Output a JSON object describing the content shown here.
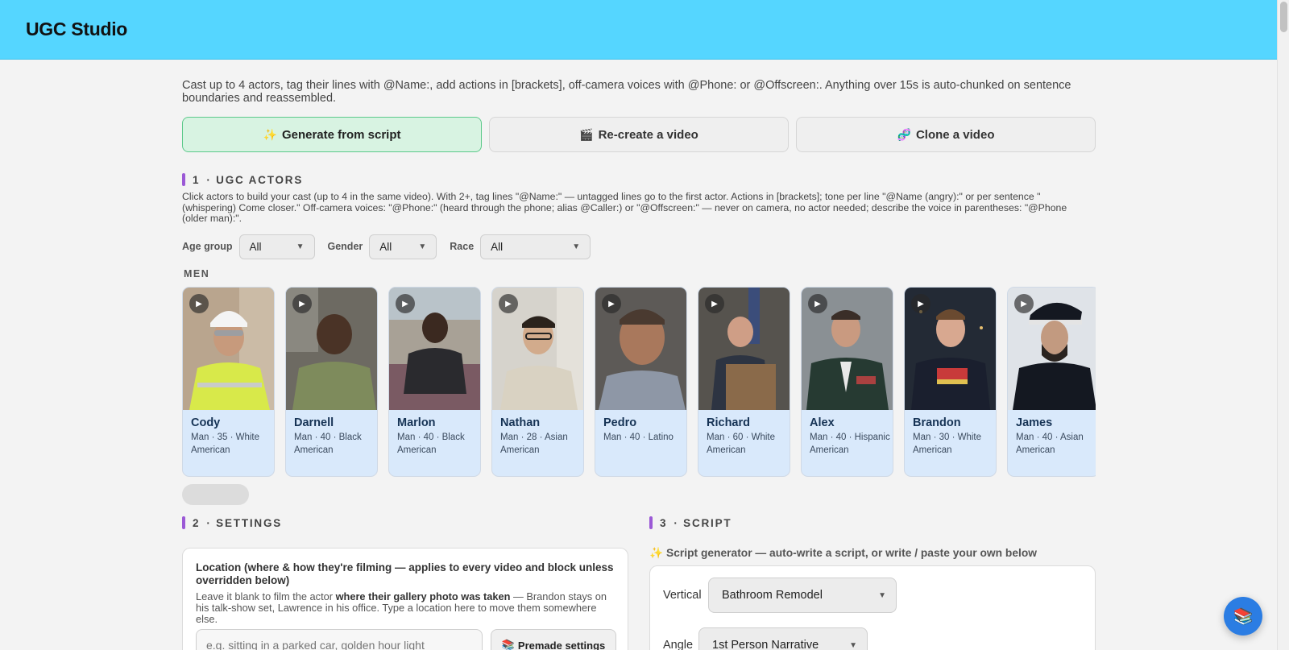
{
  "app": {
    "title": "UGC Studio"
  },
  "intro": "Cast up to 4 actors, tag their lines with @Name:, add actions in [brackets], off-camera voices with @Phone: or @Offscreen:. Anything over 15s is auto-chunked on sentence boundaries and reassembled.",
  "modes": [
    {
      "label": "Generate from script",
      "glyph": "✨",
      "active": true
    },
    {
      "label": "Re-create a video",
      "glyph": "🎬",
      "active": false
    },
    {
      "label": "Clone a video",
      "glyph": "🧬",
      "active": false
    }
  ],
  "sections": {
    "actors": {
      "num": "1",
      "title": "· UGC ACTORS"
    },
    "settings": {
      "num": "2",
      "title": "· SETTINGS"
    },
    "script": {
      "num": "3",
      "title": "· SCRIPT"
    }
  },
  "actors_help": "Click actors to build your cast (up to 4 in the same video). With 2+, tag lines \"@Name:\" — untagged lines go to the first actor. Actions in [brackets]; tone per line \"@Name (angry):\" or per sentence \"(whispering) Come closer.\" Off-camera voices: \"@Phone:\" (heard through the phone; alias @Caller:) or \"@Offscreen:\" — never on camera, no actor needed; describe the voice in parentheses: \"@Phone (older man):\".",
  "filters": [
    {
      "label": "Age group",
      "value": "All"
    },
    {
      "label": "Gender",
      "value": "All"
    },
    {
      "label": "Race",
      "value": "All"
    }
  ],
  "group_label": "MEN",
  "actors": [
    {
      "name": "Cody",
      "meta": "Man · 35 · White American"
    },
    {
      "name": "Darnell",
      "meta": "Man · 40 · Black American"
    },
    {
      "name": "Marlon",
      "meta": "Man · 40 · Black American"
    },
    {
      "name": "Nathan",
      "meta": "Man · 28 · Asian American"
    },
    {
      "name": "Pedro",
      "meta": "Man · 40 · Latino"
    },
    {
      "name": "Richard",
      "meta": "Man · 60 · White American"
    },
    {
      "name": "Alex",
      "meta": "Man · 40 · Hispanic American"
    },
    {
      "name": "Brandon",
      "meta": "Man · 30 · White American"
    },
    {
      "name": "James",
      "meta": "Man · 40 · Asian American"
    }
  ],
  "location": {
    "title": "Location (where & how they're filming — applies to every video and block unless overridden below)",
    "desc_before": "Leave it blank to film the actor ",
    "desc_bold": "where their gallery photo was taken",
    "desc_after": " — Brandon stays on his talk-show set, Lawrence in his office. Type a location here to move them somewhere else.",
    "placeholder": "e.g. sitting in a parked car, golden hour light",
    "premade_label": "Premade settings",
    "premade_glyph": "📚"
  },
  "script": {
    "gen_label": "✨ Script generator — auto-write a script, or write / paste your own below",
    "vertical_label": "Vertical",
    "vertical_value": "Bathroom Remodel",
    "angle_label": "Angle",
    "angle_value": "1st Person Narrative"
  },
  "fab_glyph": "📚"
}
